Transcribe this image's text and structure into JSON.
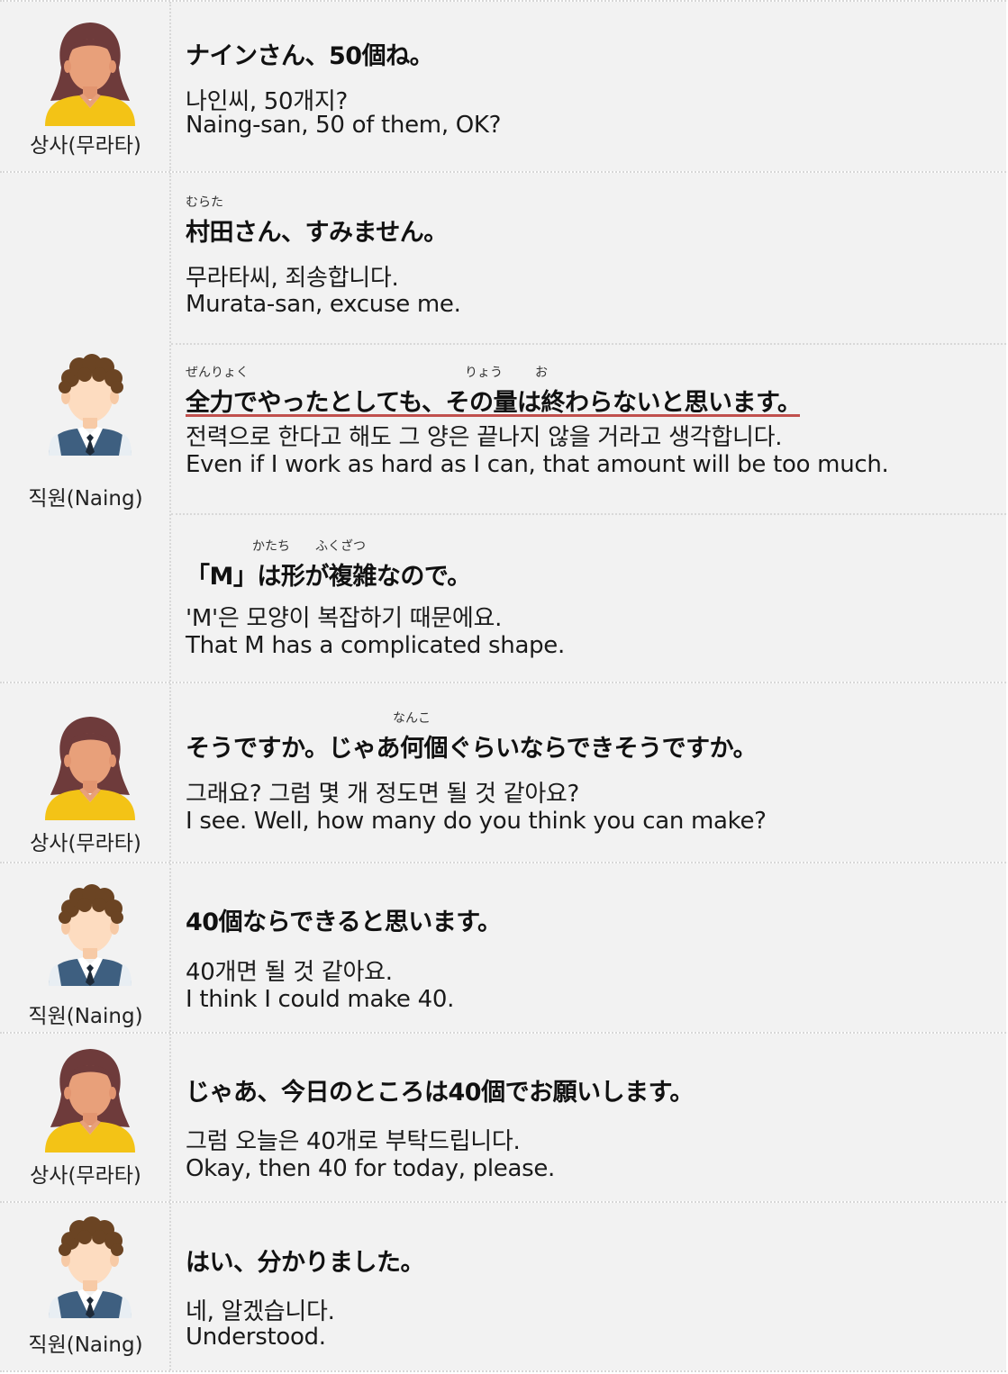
{
  "speakers": {
    "boss": "상사(무라타)",
    "staff": "직원(Naing)"
  },
  "turns": [
    {
      "speaker_role": "boss",
      "lines": [
        {
          "jp": "ナインさん、50個ね。",
          "ko": "나인씨, 50개지?",
          "en": "Naing-san, 50 of them, OK?"
        }
      ]
    },
    {
      "speaker_role": "staff",
      "lines": [
        {
          "furigana": [
            "むらた"
          ],
          "jp": "村田さん、すみません。",
          "ko": "무라타씨, 죄송합니다.",
          "en": "Murata-san, excuse me."
        },
        {
          "furigana": [
            "ぜんりょく",
            "りょう",
            "お"
          ],
          "jp": "全力でやったとしても、その量は終わらないと思います。",
          "ko": "전력으로 한다고 해도 그 양은 끝나지 않을 거라고 생각합니다.",
          "en": "Even if I work as hard as I can, that amount will be too much."
        },
        {
          "furigana": [
            "かたち",
            "ふくざつ"
          ],
          "jp": "「M」は形が複雑なので。",
          "ko": "'M'은 모양이 복잡하기 때문에요.",
          "en": "That M has a complicated shape."
        }
      ]
    },
    {
      "speaker_role": "boss",
      "lines": [
        {
          "furigana": [
            "なんこ"
          ],
          "jp": "そうですか。じゃあ何個ぐらいならできそうですか。",
          "ko": "그래요? 그럼 몇 개 정도면 될 것 같아요?",
          "en": "I see. Well, how many do you think you can make?"
        }
      ]
    },
    {
      "speaker_role": "staff",
      "lines": [
        {
          "jp": "40個ならできると思います。",
          "ko": "40개면 될 것 같아요.",
          "en": "I think I could make 40."
        }
      ]
    },
    {
      "speaker_role": "boss",
      "lines": [
        {
          "jp": "じゃあ、今日のところは40個でお願いします。",
          "ko": "그럼 오늘은 40개로 부탁드립니다.",
          "en": "Okay, then 40 for today, please."
        }
      ]
    },
    {
      "speaker_role": "staff",
      "lines": [
        {
          "jp": "はい、分かりました。",
          "ko": "네, 알겠습니다.",
          "en": "Understood."
        }
      ]
    }
  ],
  "colors": {
    "panel": "#f2f2f2",
    "divider": "#d8d8d8",
    "underline": "#c0504d",
    "boss_hair": "#6e3b3b",
    "boss_skin": "#e8a07a",
    "boss_top": "#f3c316",
    "staff_hair": "#6b4423",
    "staff_skin": "#fddcc0",
    "staff_vest": "#3e5f80"
  },
  "icons": {
    "boss": "female-avatar-icon",
    "staff": "male-avatar-icon"
  }
}
